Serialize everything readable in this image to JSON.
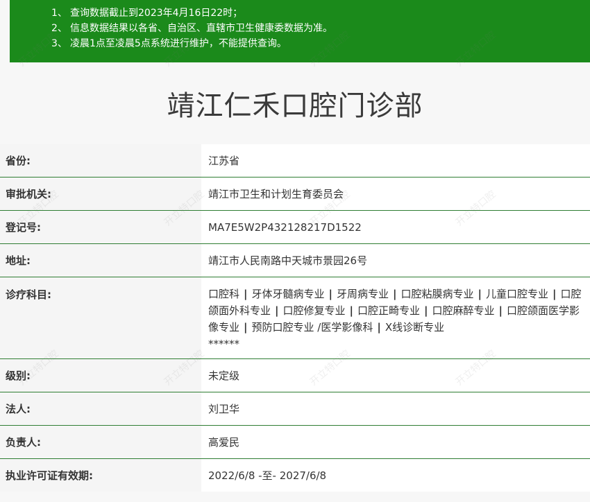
{
  "notice": [
    {
      "num": "1、",
      "text": "查询数据截止到2023年4月16日22时；"
    },
    {
      "num": "2、",
      "text": "信息数据结果以各省、自治区、直辖市卫生健康委数据为准。"
    },
    {
      "num": "3、",
      "text": "凌晨1点至凌晨5点系统进行维护，不能提供查询。"
    }
  ],
  "title": "靖江仁禾口腔门诊部",
  "rows": {
    "province": {
      "label": "省份:",
      "value": "江苏省"
    },
    "authority": {
      "label": "审批机关:",
      "value": "靖江市卫生和计划生育委员会"
    },
    "reg_no": {
      "label": "登记号:",
      "value": "MA7E5W2P432128217D1522"
    },
    "address": {
      "label": "地址:",
      "value": "靖江市人民南路中天城市景园26号"
    },
    "departments": {
      "label": "诊疗科目:",
      "items": [
        "口腔科",
        "牙体牙髓病专业",
        "牙周病专业",
        "口腔粘膜病专业",
        "儿童口腔专业",
        "口腔颌面外科专业",
        "口腔修复专业",
        "口腔正畸专业",
        "口腔麻醉专业",
        "口腔颌面医学影像专业",
        "预防口腔专业 /医学影像科",
        "X线诊断专业",
        "******"
      ]
    },
    "level": {
      "label": "级别:",
      "value": "未定级"
    },
    "legal_person": {
      "label": "法人:",
      "value": "刘卫华"
    },
    "person_in_charge": {
      "label": "负责人:",
      "value": "高爱民"
    },
    "license_validity": {
      "label": "执业许可证有效期:",
      "value": "2022/6/8 -至- 2027/6/8"
    }
  },
  "watermark": "开立特口腔"
}
